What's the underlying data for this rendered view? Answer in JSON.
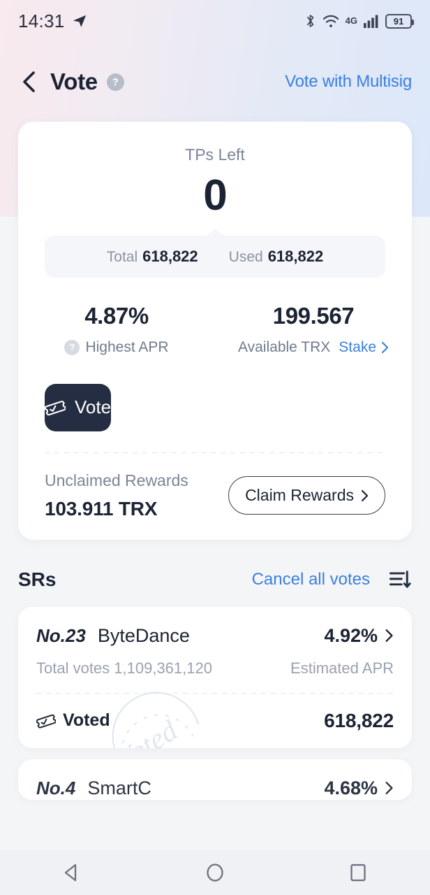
{
  "status_bar": {
    "time": "14:31",
    "send_icon": "telegram-send-icon",
    "bluetooth_icon": "bluetooth-icon",
    "wifi_icon": "wifi-icon",
    "network_label": "4G",
    "signal_icon": "cellular-signal-icon",
    "battery_level": "91"
  },
  "header": {
    "back_icon": "back-chevron-icon",
    "title": "Vote",
    "help_icon_label": "?",
    "multisig_link": "Vote with Multisig"
  },
  "summary": {
    "tps_label": "TPs Left",
    "tps_value": "0",
    "total_label": "Total",
    "total_value": "618,822",
    "used_label": "Used",
    "used_value": "618,822",
    "apr_value": "4.87%",
    "apr_label": "Highest APR",
    "apr_help_icon_label": "?",
    "trx_value": "199.567",
    "trx_label": "Available TRX",
    "stake_link": "Stake",
    "vote_button": "Vote",
    "vote_icon": "ticket-vote-icon"
  },
  "rewards": {
    "label": "Unclaimed Rewards",
    "value": "103.911 TRX",
    "claim_button": "Claim Rewards"
  },
  "sr_section": {
    "title": "SRs",
    "cancel_all_link": "Cancel all votes",
    "sort_icon": "sort-descending-icon",
    "cards": [
      {
        "rank": "No.23",
        "name": "ByteDance",
        "apr": "4.92%",
        "total_votes_label": "Total votes 1,109,361,120",
        "apr_label": "Estimated APR",
        "voted_label": "Voted",
        "voted_icon": "ticket-check-icon",
        "voted_count": "618,822",
        "stamp_text": "Voted"
      },
      {
        "rank": "No.4",
        "name": "SmartC",
        "apr": "4.68%"
      }
    ]
  },
  "nav_bar": {
    "back_icon": "triangle-back-icon",
    "home_icon": "circle-home-icon",
    "recents_icon": "square-recents-icon"
  },
  "colors": {
    "accent_blue": "#3a7fe0",
    "dark_navy": "#252d42",
    "muted_gray": "#7b8496"
  }
}
